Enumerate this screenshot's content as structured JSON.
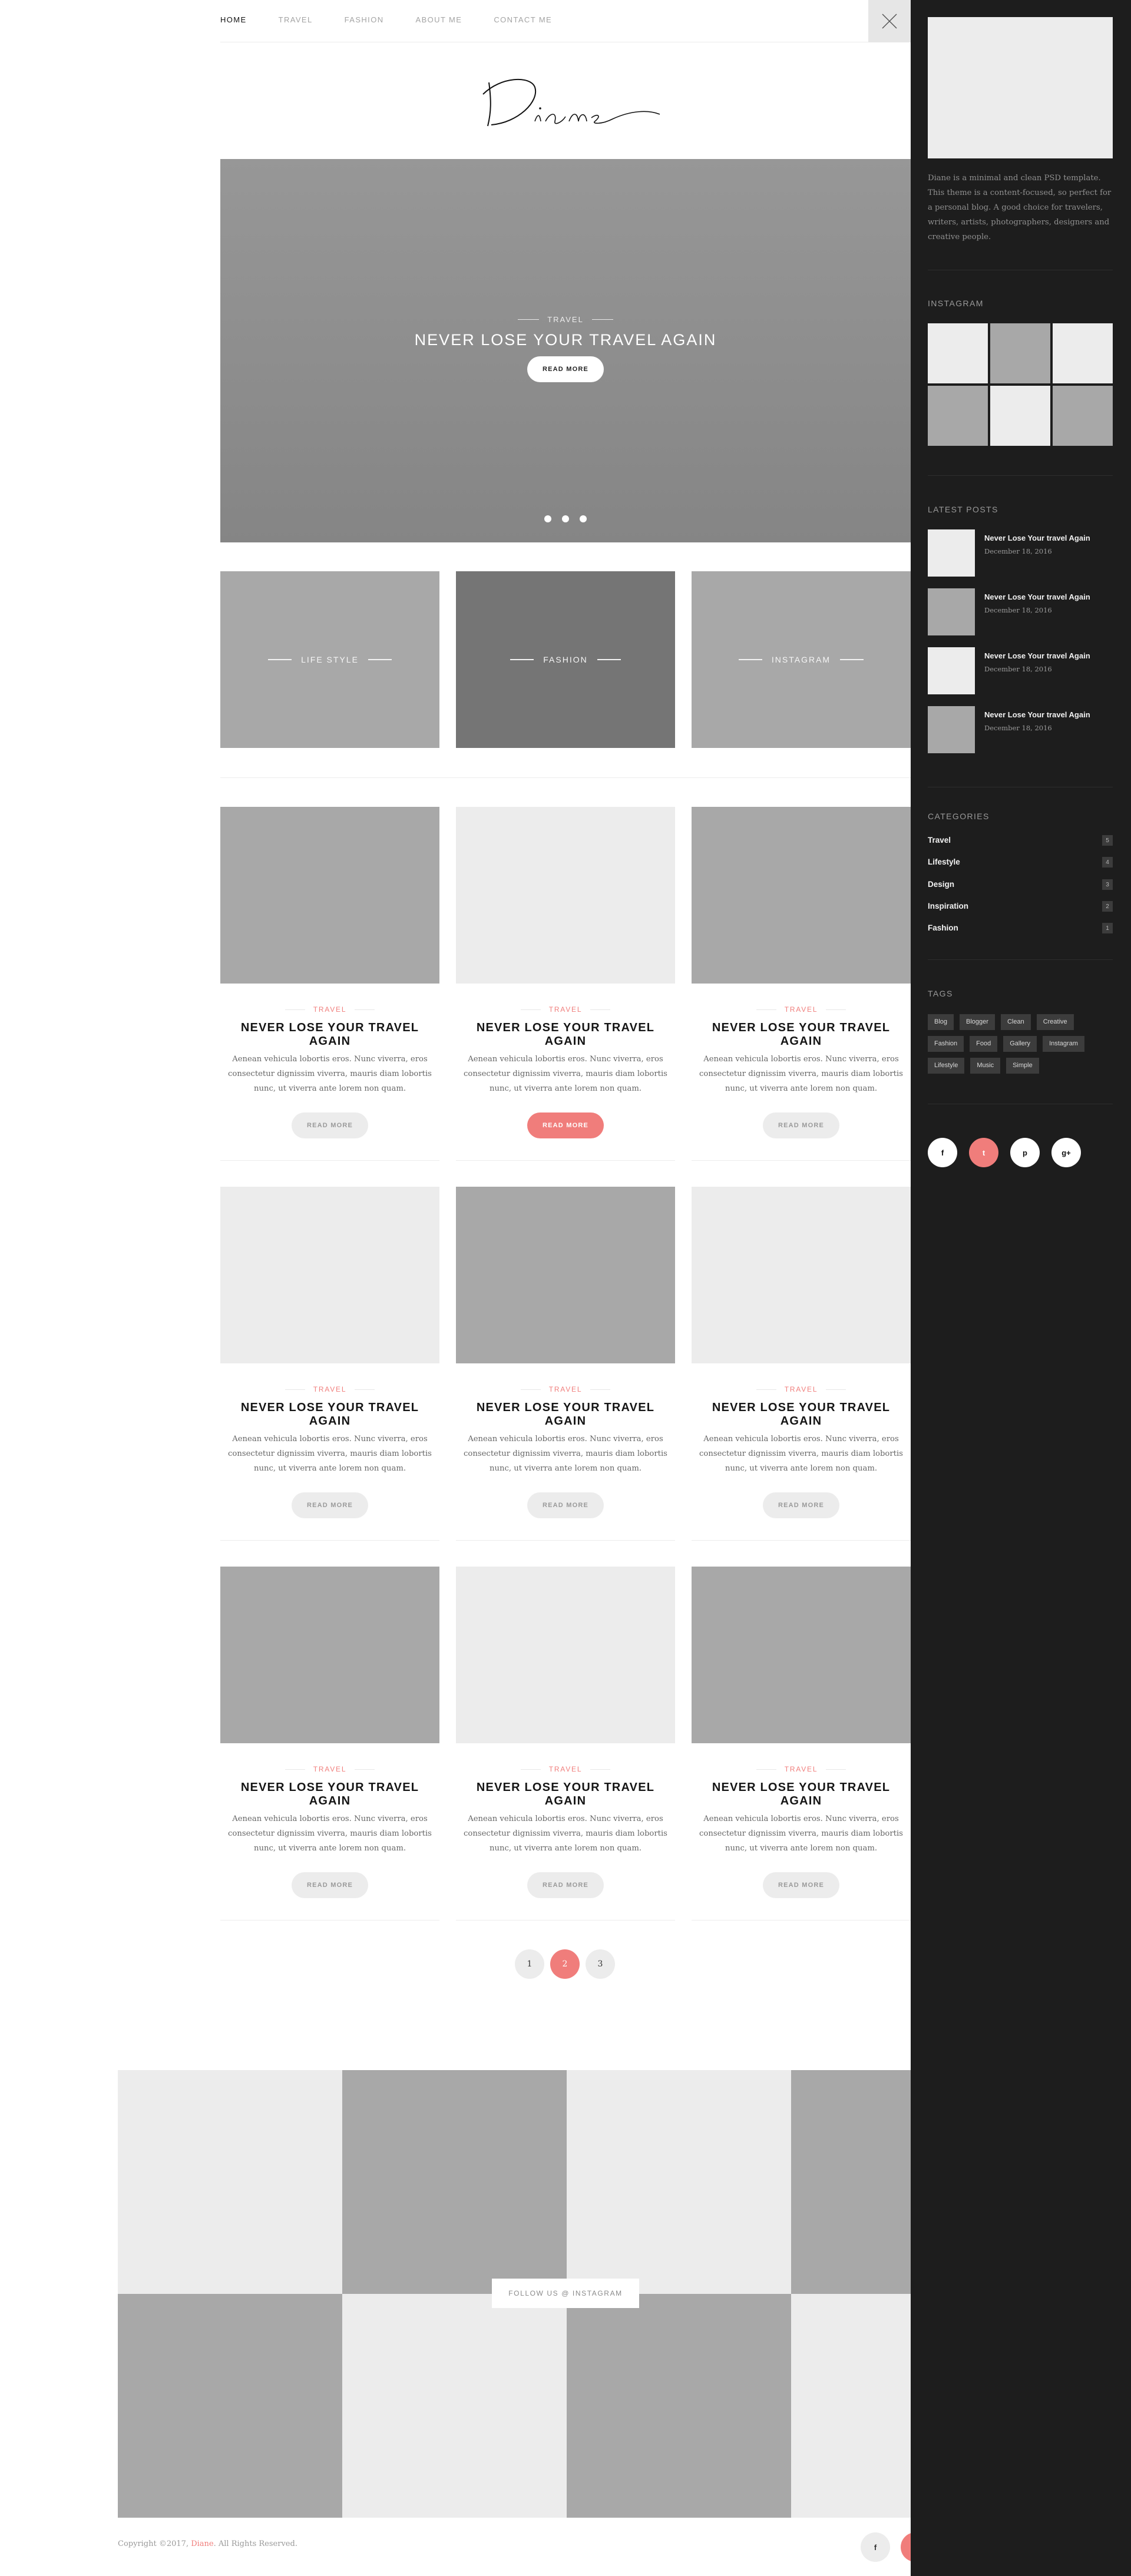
{
  "nav": {
    "items": [
      "HOME",
      "TRAVEL",
      "FASHION",
      "ABOUT ME",
      "CONTACT ME"
    ]
  },
  "logo": {
    "text": "Diane"
  },
  "hero": {
    "category": "TRAVEL",
    "title": "NEVER LOSE YOUR TRAVEL AGAIN",
    "button": "READ MORE"
  },
  "categories": [
    "LIFE STYLE",
    "FASHION",
    "INSTAGRAM"
  ],
  "posts": [
    {
      "category": "TRAVEL",
      "title": "NEVER LOSE YOUR TRAVEL AGAIN",
      "excerpt": "Aenean vehicula lobortis eros. Nunc viverra, eros consectetur dignissim viverra, mauris diam lobortis nunc, ut viverra ante lorem non quam.",
      "button": "READ MORE"
    },
    {
      "category": "TRAVEL",
      "title": "NEVER LOSE YOUR TRAVEL AGAIN",
      "excerpt": "Aenean vehicula lobortis eros. Nunc viverra, eros consectetur dignissim viverra, mauris diam lobortis nunc, ut viverra ante lorem non quam.",
      "button": "READ MORE"
    },
    {
      "category": "TRAVEL",
      "title": "NEVER LOSE YOUR TRAVEL AGAIN",
      "excerpt": "Aenean vehicula lobortis eros. Nunc viverra, eros consectetur dignissim viverra, mauris diam lobortis nunc, ut viverra ante lorem non quam.",
      "button": "READ MORE"
    },
    {
      "category": "TRAVEL",
      "title": "NEVER LOSE YOUR TRAVEL AGAIN",
      "excerpt": "Aenean vehicula lobortis eros. Nunc viverra, eros consectetur dignissim viverra, mauris diam lobortis nunc, ut viverra ante lorem non quam.",
      "button": "READ MORE"
    },
    {
      "category": "TRAVEL",
      "title": "NEVER LOSE YOUR TRAVEL AGAIN",
      "excerpt": "Aenean vehicula lobortis eros. Nunc viverra, eros consectetur dignissim viverra, mauris diam lobortis nunc, ut viverra ante lorem non quam.",
      "button": "READ MORE"
    },
    {
      "category": "TRAVEL",
      "title": "NEVER LOSE YOUR TRAVEL AGAIN",
      "excerpt": "Aenean vehicula lobortis eros. Nunc viverra, eros consectetur dignissim viverra, mauris diam lobortis nunc, ut viverra ante lorem non quam.",
      "button": "READ MORE"
    },
    {
      "category": "TRAVEL",
      "title": "NEVER LOSE YOUR TRAVEL AGAIN",
      "excerpt": "Aenean vehicula lobortis eros. Nunc viverra, eros consectetur dignissim viverra, mauris diam lobortis nunc, ut viverra ante lorem non quam.",
      "button": "READ MORE"
    },
    {
      "category": "TRAVEL",
      "title": "NEVER LOSE YOUR TRAVEL AGAIN",
      "excerpt": "Aenean vehicula lobortis eros. Nunc viverra, eros consectetur dignissim viverra, mauris diam lobortis nunc, ut viverra ante lorem non quam.",
      "button": "READ MORE"
    },
    {
      "category": "TRAVEL",
      "title": "NEVER LOSE YOUR TRAVEL AGAIN",
      "excerpt": "Aenean vehicula lobortis eros. Nunc viverra, eros consectetur dignissim viverra, mauris diam lobortis nunc, ut viverra ante lorem non quam.",
      "button": "READ MORE"
    }
  ],
  "pagination": [
    "1",
    "2",
    "3"
  ],
  "instagram_footer": {
    "button": "FOLLOW US @ INSTAGRAM"
  },
  "footer": {
    "copyright_prefix": "Copyright ©2017, ",
    "copyright_brand": "Diane",
    "copyright_suffix": ". All Rights Reserved."
  },
  "social": [
    "f",
    "t",
    "p",
    "g+"
  ],
  "sidebar": {
    "about": "Diane is a minimal and clean PSD template. This theme is a content-focused, so perfect for a personal blog. A good choice for travelers, writers, artists, photographers, designers and creative people.",
    "instagram_heading": "INSTAGRAM",
    "latest_heading": "LATEST POSTS",
    "latest_posts": [
      {
        "title": "Never Lose Your travel Again",
        "date": "December 18, 2016"
      },
      {
        "title": "Never Lose Your travel Again",
        "date": "December 18, 2016"
      },
      {
        "title": "Never Lose Your travel Again",
        "date": "December 18, 2016"
      },
      {
        "title": "Never Lose Your travel Again",
        "date": "December 18, 2016"
      }
    ],
    "categories_heading": "CATEGORIES",
    "categories": [
      {
        "name": "Travel",
        "count": "5"
      },
      {
        "name": "Lifestyle",
        "count": "4"
      },
      {
        "name": "Design",
        "count": "3"
      },
      {
        "name": "Inspiration",
        "count": "2"
      },
      {
        "name": "Fashion",
        "count": "1"
      }
    ],
    "tags_heading": "TAGS",
    "tags": [
      "Blog",
      "Blogger",
      "Clean",
      "Creative",
      "Fashion",
      "Food",
      "Gallery",
      "Instagram",
      "Lifestyle",
      "Music",
      "Simple"
    ]
  },
  "colors": {
    "accent": "#f07d7b",
    "sidebar_bg": "#1d1d1d",
    "placeholder_light": "#ececec",
    "placeholder_mid": "#a8a8a8",
    "placeholder_dark": "#7a7a7a"
  }
}
